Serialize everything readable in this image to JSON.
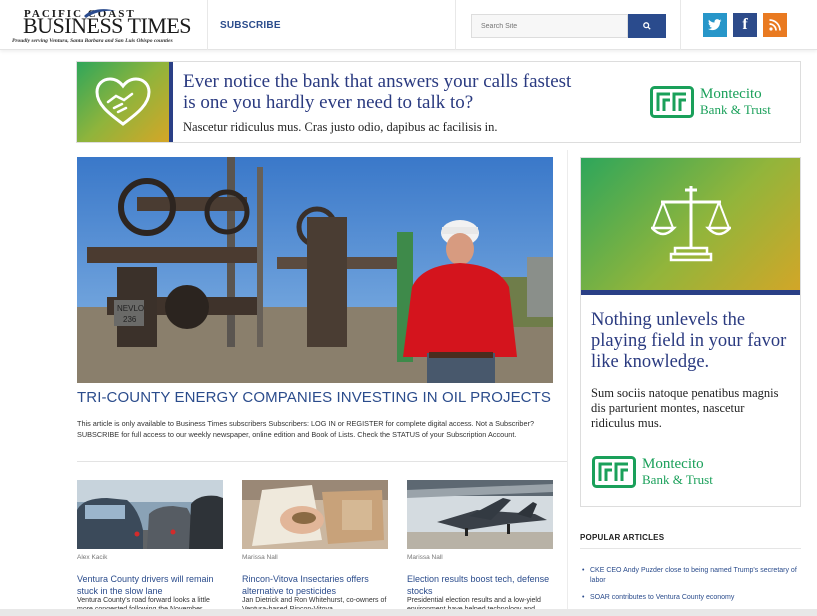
{
  "header": {
    "logo_top": "PACIFIC COAST",
    "logo_main": "BUSINESS TIMES",
    "logo_tagline": "Proudly serving Ventura, Santa Barbara and San Luis Obispo counties",
    "subscribe_label": "SUBSCRIBE",
    "search_placeholder": "Search Site",
    "social": [
      "twitter-icon",
      "facebook-icon",
      "rss-icon"
    ]
  },
  "banner_ad": {
    "headline": "Ever notice the bank that answers your calls fastest is one you hardly ever need to talk to?",
    "subtext": "Nascetur ridiculus mus. Cras justo odio, dapibus ac facilisis in.",
    "brand_line1": "Montecito",
    "brand_line2": "Bank & Trust",
    "brand_color": "#1aa05a",
    "accent_color": "#2a3f86"
  },
  "feature": {
    "image_sign": "NEVLO 236",
    "title": "TRI-COUNTY ENERGY COMPANIES INVESTING IN OIL PROJECTS",
    "text": "This article is only available to Business Times subscribers Subscribers: LOG IN or REGISTER for complete digital access. Not a Subscriber? SUBSCRIBE for full access to our weekly newspaper, online edition and Book of Lists. Check the STATUS of your Subscription Account."
  },
  "cards": [
    {
      "author": "Alex Kacik",
      "title": "Ventura County drivers will remain stuck in the slow lane",
      "desc": "Ventura County's road forward looks a little more congested following the November"
    },
    {
      "author": "Marissa Nall",
      "title": "Rincon-Vitova Insectaries offers alternative to pesticides",
      "desc": "Jan Dietrick and Ron Whitehurst, co-owners of Ventura-based Rincon-Vitova"
    },
    {
      "author": "Marissa Nall",
      "title": "Election results boost tech, defense stocks",
      "desc": "Presidential election results and a low-yield environment have helped technology and"
    }
  ],
  "side_ad": {
    "headline": "Nothing unlevels the playing field in your favor like knowledge.",
    "subtext": "Sum sociis natoque penatibus magnis dis parturient montes, nascetur ridiculus mus.",
    "brand_line1": "Montecito",
    "brand_line2": "Bank & Trust"
  },
  "popular": {
    "heading": "POPULAR ARTICLES",
    "items": [
      "CKE CEO Andy Puzder close to being named Trump's secretary of labor",
      "SOAR contributes to Ventura County economy"
    ]
  }
}
